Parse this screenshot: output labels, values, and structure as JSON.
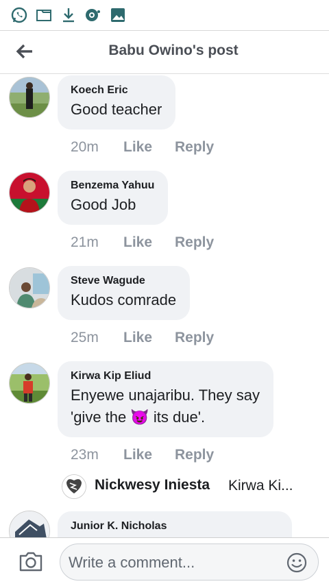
{
  "header": {
    "title": "Babu Owino's post"
  },
  "status_icons": [
    "whatsapp-icon",
    "folder-icon",
    "download-icon",
    "hotspot-icon",
    "image-icon"
  ],
  "comments": [
    {
      "name": "Koech Eric",
      "text": "Good teacher",
      "time": "20m",
      "like": "Like",
      "reply": "Reply"
    },
    {
      "name": "Benzema Yahuu",
      "text": "Good Job",
      "time": "21m",
      "like": "Like",
      "reply": "Reply"
    },
    {
      "name": "Steve Wagude",
      "text": "Kudos comrade",
      "time": "25m",
      "like": "Like",
      "reply": "Reply"
    },
    {
      "name": "Kirwa Kip Eliud",
      "text_line1": "Enyewe unajaribu. They say",
      "text_line2_pre": "'give the",
      "text_line2_post": "its due'.",
      "emoji": "😈",
      "time": "23m",
      "like": "Like",
      "reply": "Reply"
    },
    {
      "name": "Junior K. Nicholas"
    }
  ],
  "reply_preview": {
    "name": "Nickwesy Iniesta",
    "snippet": "Kirwa Ki..."
  },
  "composer": {
    "placeholder": "Write a comment..."
  }
}
